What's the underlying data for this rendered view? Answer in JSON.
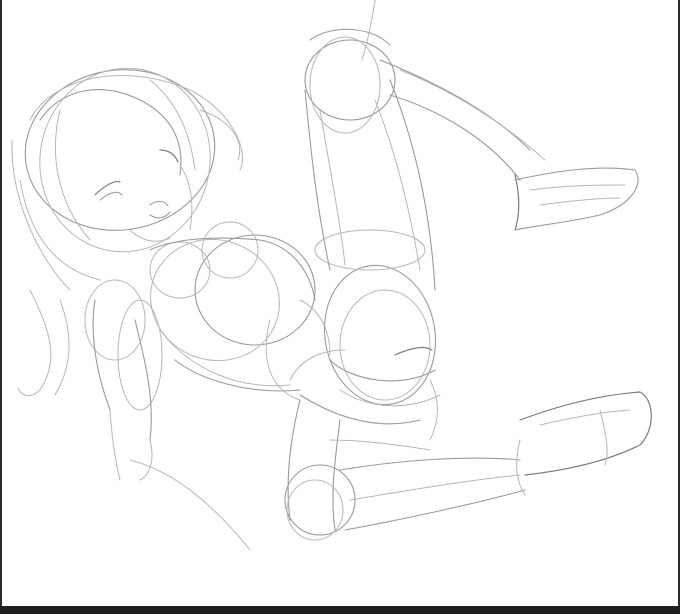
{
  "image": {
    "subject": "pencil-sketch",
    "colors": {
      "background": "#ffffff",
      "stroke_light": "#b7b7b7",
      "stroke_mid": "#9a9a9a",
      "stroke_dark": "#7d7d7d",
      "frame_edge": "#2b2b2b"
    }
  }
}
